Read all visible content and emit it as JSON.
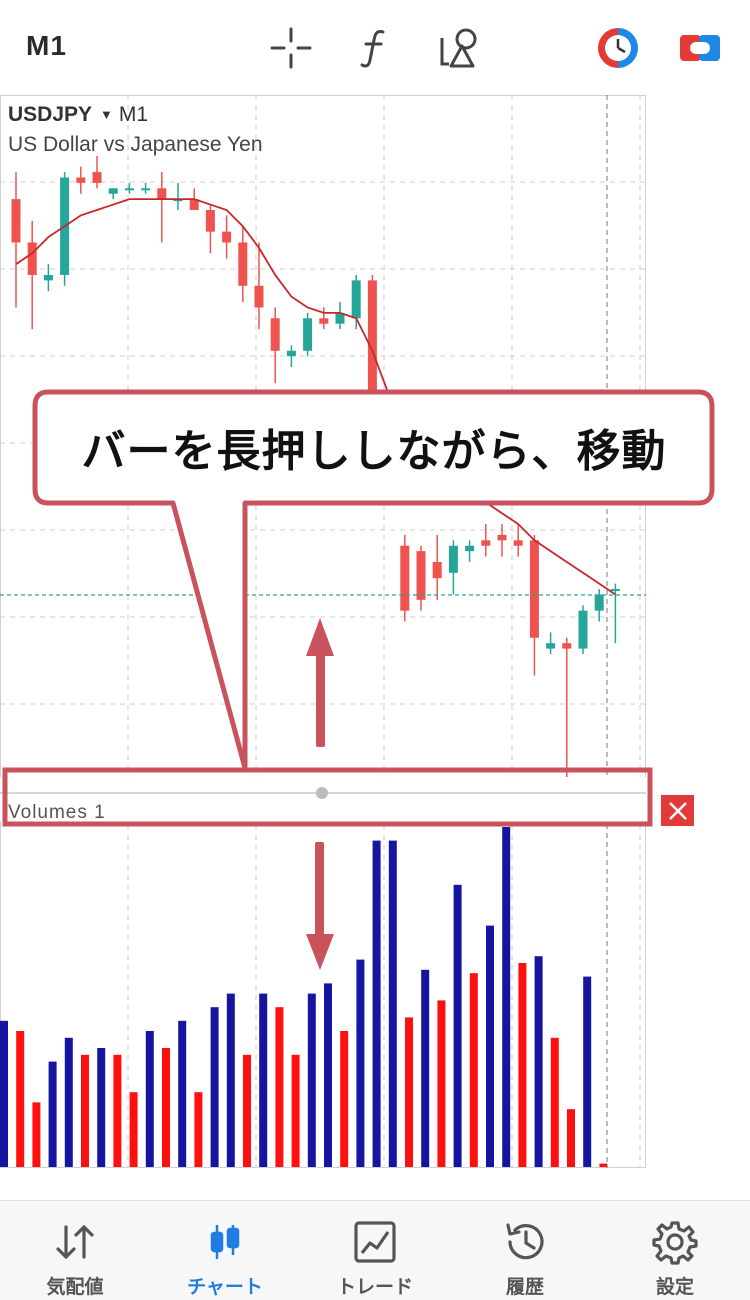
{
  "toolbar": {
    "timeframe": "M1",
    "icons": [
      "crosshair-icon",
      "function-icon",
      "objects-icon",
      "clock-icon",
      "toggle-icon"
    ]
  },
  "chart": {
    "symbol": "USDJPY",
    "timeframe": "M1",
    "description": "US Dollar vs Japanese Yen",
    "colors": {
      "bull": "#26a69a",
      "bear": "#ef5350",
      "ma": "#c62828",
      "grid": "#cfcfcf"
    },
    "candles": [
      {
        "o": 0.1,
        "h": 0.05,
        "l": 0.3,
        "c": 0.18,
        "d": "bear"
      },
      {
        "o": 0.18,
        "h": 0.14,
        "l": 0.34,
        "c": 0.24,
        "d": "bear"
      },
      {
        "o": 0.25,
        "h": 0.22,
        "l": 0.27,
        "c": 0.24,
        "d": "bull"
      },
      {
        "o": 0.24,
        "h": 0.05,
        "l": 0.26,
        "c": 0.06,
        "d": "bull"
      },
      {
        "o": 0.06,
        "h": 0.04,
        "l": 0.09,
        "c": 0.07,
        "d": "bear"
      },
      {
        "o": 0.05,
        "h": 0.02,
        "l": 0.08,
        "c": 0.07,
        "d": "bear"
      },
      {
        "o": 0.09,
        "h": 0.08,
        "l": 0.1,
        "c": 0.08,
        "d": "bull"
      },
      {
        "o": 0.08,
        "h": 0.07,
        "l": 0.09,
        "c": 0.08,
        "d": "bull"
      },
      {
        "o": 0.08,
        "h": 0.07,
        "l": 0.09,
        "c": 0.08,
        "d": "bull"
      },
      {
        "o": 0.08,
        "h": 0.05,
        "l": 0.18,
        "c": 0.1,
        "d": "bear"
      },
      {
        "o": 0.1,
        "h": 0.07,
        "l": 0.12,
        "c": 0.1,
        "d": "bull"
      },
      {
        "o": 0.1,
        "h": 0.08,
        "l": 0.12,
        "c": 0.12,
        "d": "bear"
      },
      {
        "o": 0.12,
        "h": 0.11,
        "l": 0.2,
        "c": 0.16,
        "d": "bear"
      },
      {
        "o": 0.16,
        "h": 0.13,
        "l": 0.21,
        "c": 0.18,
        "d": "bear"
      },
      {
        "o": 0.18,
        "h": 0.15,
        "l": 0.29,
        "c": 0.26,
        "d": "bear"
      },
      {
        "o": 0.26,
        "h": 0.18,
        "l": 0.34,
        "c": 0.3,
        "d": "bear"
      },
      {
        "o": 0.32,
        "h": 0.3,
        "l": 0.44,
        "c": 0.38,
        "d": "bear"
      },
      {
        "o": 0.39,
        "h": 0.37,
        "l": 0.41,
        "c": 0.38,
        "d": "bull"
      },
      {
        "o": 0.38,
        "h": 0.31,
        "l": 0.39,
        "c": 0.32,
        "d": "bull"
      },
      {
        "o": 0.32,
        "h": 0.3,
        "l": 0.34,
        "c": 0.33,
        "d": "bear"
      },
      {
        "o": 0.33,
        "h": 0.29,
        "l": 0.34,
        "c": 0.31,
        "d": "bull"
      },
      {
        "o": 0.32,
        "h": 0.24,
        "l": 0.34,
        "c": 0.25,
        "d": "bull"
      },
      {
        "o": 0.25,
        "h": 0.24,
        "l": 0.5,
        "c": 0.49,
        "d": "bear"
      },
      {
        "o": 0.5,
        "h": 0.48,
        "l": 0.56,
        "c": 0.55,
        "d": "bear"
      },
      {
        "o": 0.74,
        "h": 0.72,
        "l": 0.88,
        "c": 0.86,
        "d": "bear"
      },
      {
        "o": 0.75,
        "h": 0.74,
        "l": 0.86,
        "c": 0.84,
        "d": "bear"
      },
      {
        "o": 0.77,
        "h": 0.72,
        "l": 0.84,
        "c": 0.8,
        "d": "bear"
      },
      {
        "o": 0.79,
        "h": 0.73,
        "l": 0.83,
        "c": 0.74,
        "d": "bull"
      },
      {
        "o": 0.74,
        "h": 0.73,
        "l": 0.77,
        "c": 0.75,
        "d": "bull"
      },
      {
        "o": 0.74,
        "h": 0.7,
        "l": 0.76,
        "c": 0.73,
        "d": "bear"
      },
      {
        "o": 0.72,
        "h": 0.7,
        "l": 0.76,
        "c": 0.73,
        "d": "bear"
      },
      {
        "o": 0.73,
        "h": 0.7,
        "l": 0.76,
        "c": 0.74,
        "d": "bear"
      },
      {
        "o": 0.73,
        "h": 0.72,
        "l": 0.98,
        "c": 0.91,
        "d": "bear"
      },
      {
        "o": 0.92,
        "h": 0.9,
        "l": 0.94,
        "c": 0.93,
        "d": "bull"
      },
      {
        "o": 0.92,
        "h": 0.91,
        "l": 1.18,
        "c": 0.93,
        "d": "bear"
      },
      {
        "o": 0.93,
        "h": 0.85,
        "l": 0.94,
        "c": 0.86,
        "d": "bull"
      },
      {
        "o": 0.86,
        "h": 0.82,
        "l": 0.88,
        "c": 0.83,
        "d": "bull"
      },
      {
        "o": 0.82,
        "h": 0.81,
        "l": 0.92,
        "c": 0.82,
        "d": "bull"
      }
    ],
    "ma": [
      0.22,
      0.2,
      0.17,
      0.15,
      0.13,
      0.12,
      0.11,
      0.1,
      0.1,
      0.1,
      0.1,
      0.1,
      0.11,
      0.12,
      0.15,
      0.19,
      0.24,
      0.28,
      0.3,
      0.31,
      0.31,
      0.32,
      0.38,
      0.46,
      0.55,
      0.58,
      0.6,
      0.62,
      0.64,
      0.66,
      0.68,
      0.7,
      0.73,
      0.75,
      0.77,
      0.79,
      0.81,
      0.83
    ],
    "volumes": {
      "bull": "#1515a0",
      "bear": "#ff1010",
      "items": [
        {
          "v": 0.43,
          "d": "bull"
        },
        {
          "v": 0.4,
          "d": "bear"
        },
        {
          "v": 0.19,
          "d": "bear"
        },
        {
          "v": 0.31,
          "d": "bull"
        },
        {
          "v": 0.38,
          "d": "bull"
        },
        {
          "v": 0.33,
          "d": "bear"
        },
        {
          "v": 0.35,
          "d": "bull"
        },
        {
          "v": 0.33,
          "d": "bear"
        },
        {
          "v": 0.22,
          "d": "bear"
        },
        {
          "v": 0.4,
          "d": "bull"
        },
        {
          "v": 0.35,
          "d": "bear"
        },
        {
          "v": 0.43,
          "d": "bull"
        },
        {
          "v": 0.22,
          "d": "bear"
        },
        {
          "v": 0.47,
          "d": "bull"
        },
        {
          "v": 0.51,
          "d": "bull"
        },
        {
          "v": 0.33,
          "d": "bear"
        },
        {
          "v": 0.51,
          "d": "bull"
        },
        {
          "v": 0.47,
          "d": "bear"
        },
        {
          "v": 0.33,
          "d": "bear"
        },
        {
          "v": 0.51,
          "d": "bull"
        },
        {
          "v": 0.54,
          "d": "bull"
        },
        {
          "v": 0.4,
          "d": "bear"
        },
        {
          "v": 0.61,
          "d": "bull"
        },
        {
          "v": 0.96,
          "d": "bull"
        },
        {
          "v": 0.96,
          "d": "bull"
        },
        {
          "v": 0.44,
          "d": "bear"
        },
        {
          "v": 0.58,
          "d": "bull"
        },
        {
          "v": 0.49,
          "d": "bear"
        },
        {
          "v": 0.83,
          "d": "bull"
        },
        {
          "v": 0.57,
          "d": "bear"
        },
        {
          "v": 0.71,
          "d": "bull"
        },
        {
          "v": 1.0,
          "d": "bull"
        },
        {
          "v": 0.6,
          "d": "bear"
        },
        {
          "v": 0.62,
          "d": "bull"
        },
        {
          "v": 0.38,
          "d": "bear"
        },
        {
          "v": 0.17,
          "d": "bear"
        },
        {
          "v": 0.56,
          "d": "bull"
        },
        {
          "v": 0.01,
          "d": "bear"
        }
      ]
    },
    "volume_label": "Volumes 1"
  },
  "callout": {
    "text": "バーを長押ししながら、移動"
  },
  "nav": {
    "items": [
      {
        "label": "気配値",
        "icon": "quotes-icon",
        "active": false
      },
      {
        "label": "チャート",
        "icon": "chart-icon",
        "active": true
      },
      {
        "label": "トレード",
        "icon": "trade-icon",
        "active": false
      },
      {
        "label": "履歴",
        "icon": "history-icon",
        "active": false
      },
      {
        "label": "設定",
        "icon": "settings-icon",
        "active": false
      }
    ]
  }
}
